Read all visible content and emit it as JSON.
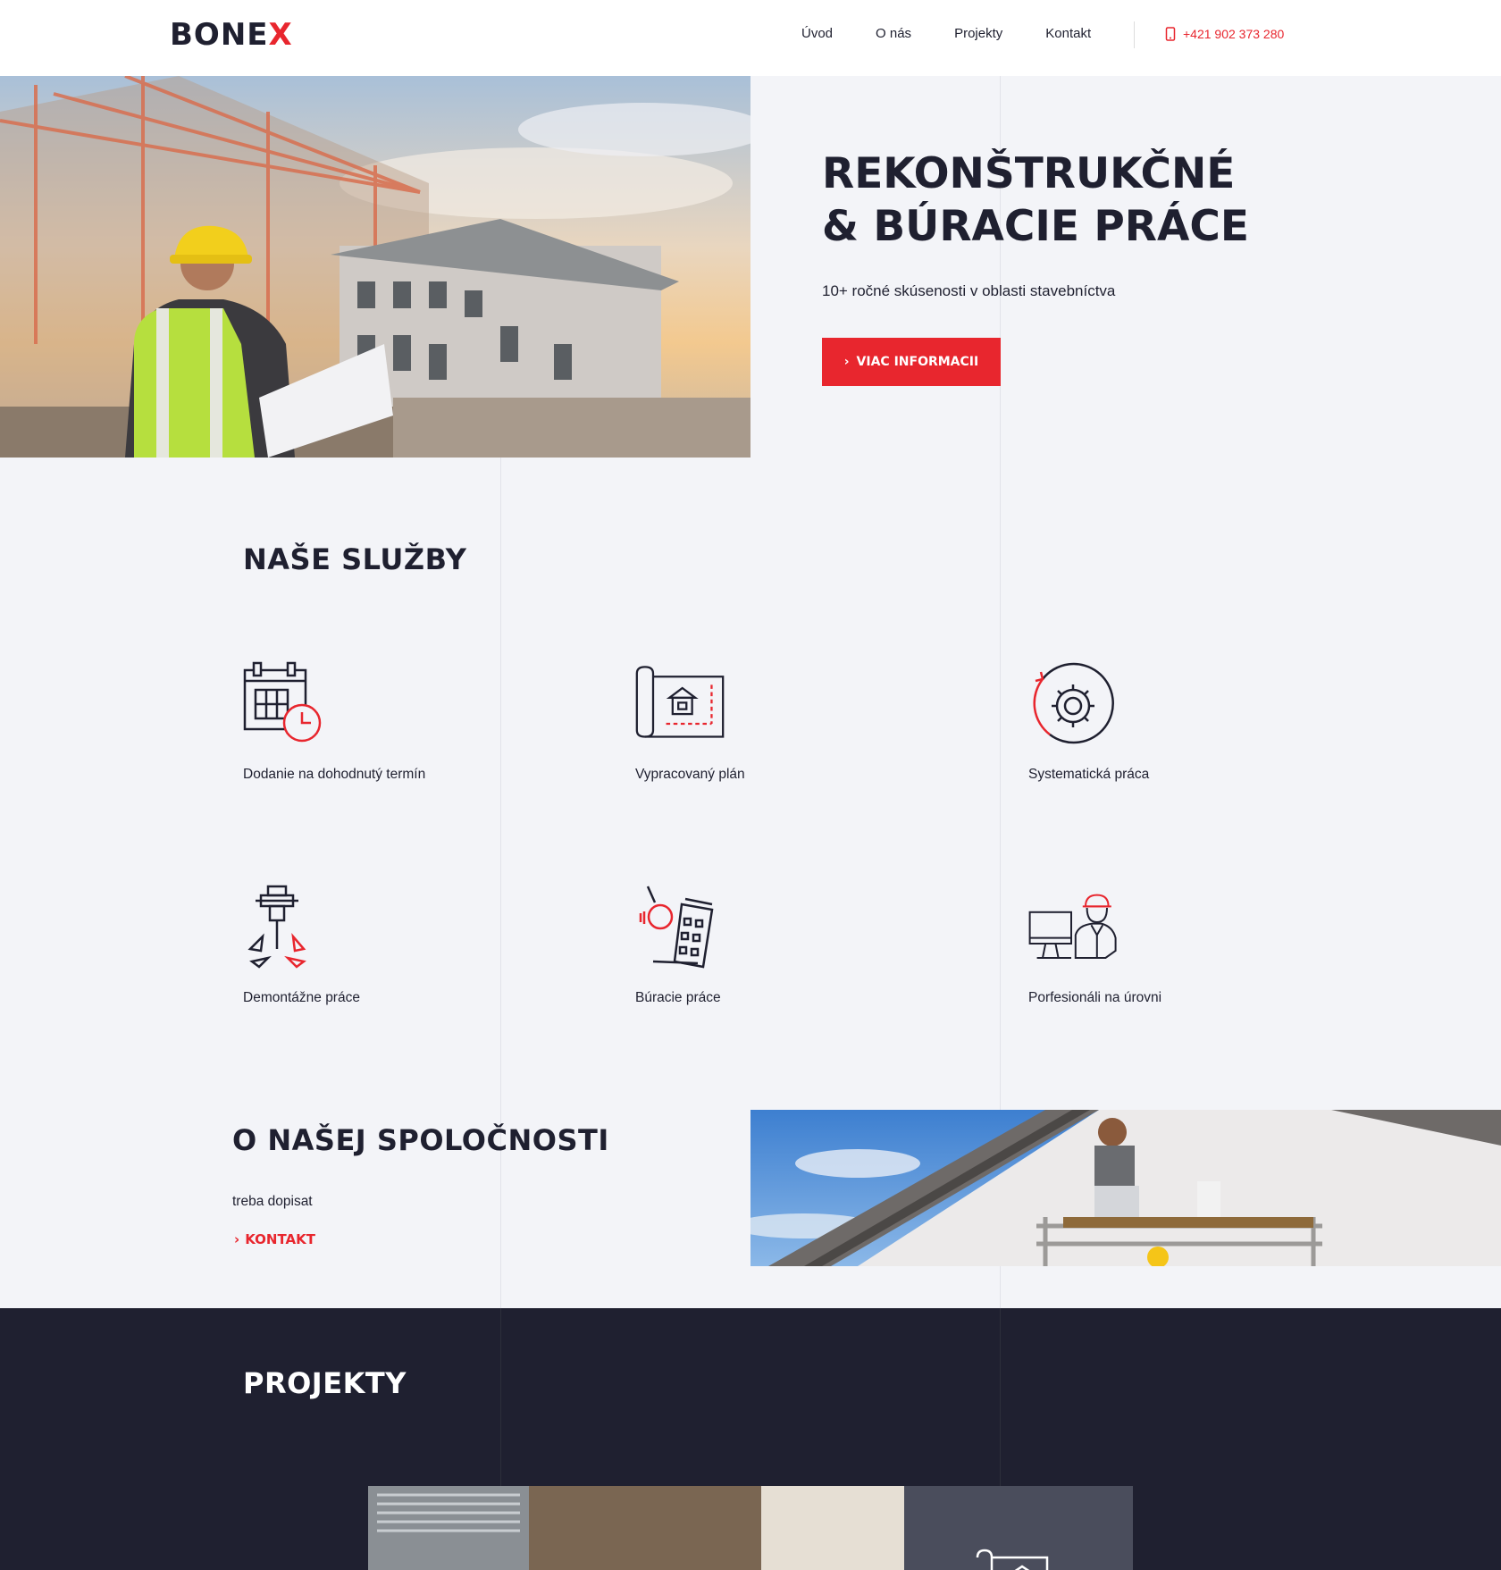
{
  "header": {
    "logo_main": "BONE",
    "logo_accent": "X",
    "nav": [
      "Úvod",
      "O nás",
      "Projekty",
      "Kontakt"
    ],
    "phone": "+421 902 373 280"
  },
  "hero": {
    "title_line1": "REKONŠTRUKČNÉ",
    "title_line2": "& BÚRACIE PRÁCE",
    "subtitle": "10+ ročné skúsenosti v oblasti stavebníctva",
    "cta_label": "VIAC INFORMACII"
  },
  "services": {
    "title": "NAŠE SLUŽBY",
    "items": [
      {
        "label": "Dodanie na dohodnutý termín",
        "icon": "calendar-clock-icon"
      },
      {
        "label": "Vypracovaný plán",
        "icon": "blueprint-icon"
      },
      {
        "label": "Systematická práca",
        "icon": "gear-cycle-icon"
      },
      {
        "label": "Demontážne práce",
        "icon": "jackhammer-icon"
      },
      {
        "label": "Búracie práce",
        "icon": "wrecking-ball-icon"
      },
      {
        "label": "Porfesionáli na úrovni",
        "icon": "engineer-computer-icon"
      }
    ]
  },
  "about": {
    "title": "O NAŠEJ SPOLOČNOSTI",
    "text": "treba dopisat",
    "link_label": "KONTAKT"
  },
  "projects": {
    "title": "PROJEKTY"
  },
  "colors": {
    "accent": "#e8262e",
    "dark": "#1f2030",
    "background": "#f3f4f8"
  }
}
